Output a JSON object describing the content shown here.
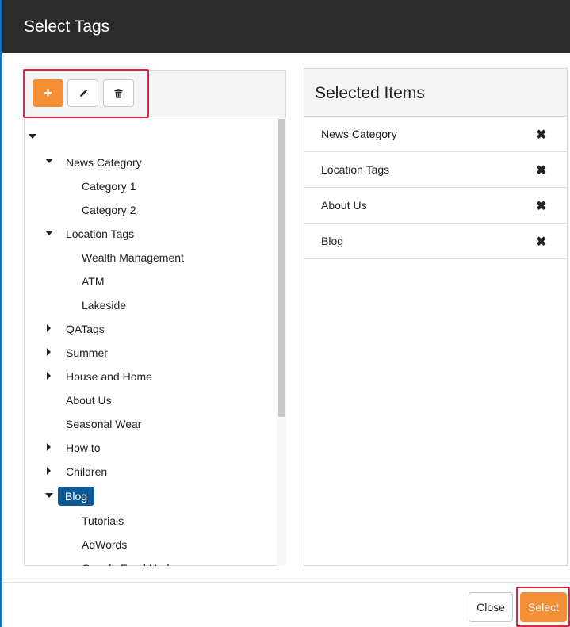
{
  "dialog": {
    "title": "Select Tags"
  },
  "toolbar": {
    "add_label": "+",
    "add_icon": "plus-icon",
    "edit_icon": "pencil-icon",
    "delete_icon": "trash-icon"
  },
  "tree": {
    "nodes": [
      {
        "label": "",
        "expander": "down"
      },
      {
        "label": "News Category",
        "expander": "down"
      },
      {
        "label": "Category 1",
        "expander": "none"
      },
      {
        "label": "Category 2",
        "expander": "none"
      },
      {
        "label": "Location Tags",
        "expander": "down"
      },
      {
        "label": "Wealth Management",
        "expander": "none"
      },
      {
        "label": "ATM",
        "expander": "none"
      },
      {
        "label": "Lakeside",
        "expander": "none"
      },
      {
        "label": "QATags",
        "expander": "right"
      },
      {
        "label": "Summer",
        "expander": "right"
      },
      {
        "label": "House and Home",
        "expander": "right"
      },
      {
        "label": "About Us",
        "expander": "none"
      },
      {
        "label": "Seasonal Wear",
        "expander": "none"
      },
      {
        "label": "How to",
        "expander": "right"
      },
      {
        "label": "Children",
        "expander": "right"
      },
      {
        "label": "Blog",
        "expander": "down",
        "selected": true
      },
      {
        "label": "Tutorials",
        "expander": "none"
      },
      {
        "label": "AdWords",
        "expander": "none"
      },
      {
        "label": "Google Feed Upd...",
        "expander": "none"
      }
    ]
  },
  "selected_panel": {
    "title": "Selected Items",
    "remove_icon": "close-icon",
    "items": [
      {
        "label": "News Category",
        "remove": "✖"
      },
      {
        "label": "Location Tags",
        "remove": "✖"
      },
      {
        "label": "About Us",
        "remove": "✖"
      },
      {
        "label": "Blog",
        "remove": "✖"
      }
    ]
  },
  "footer": {
    "close_label": "Close",
    "select_label": "Select"
  },
  "colors": {
    "accent": "#f58f35",
    "header_bg": "#2b2b2b",
    "selected_node": "#0e5a96",
    "highlight": "#e5224a"
  }
}
